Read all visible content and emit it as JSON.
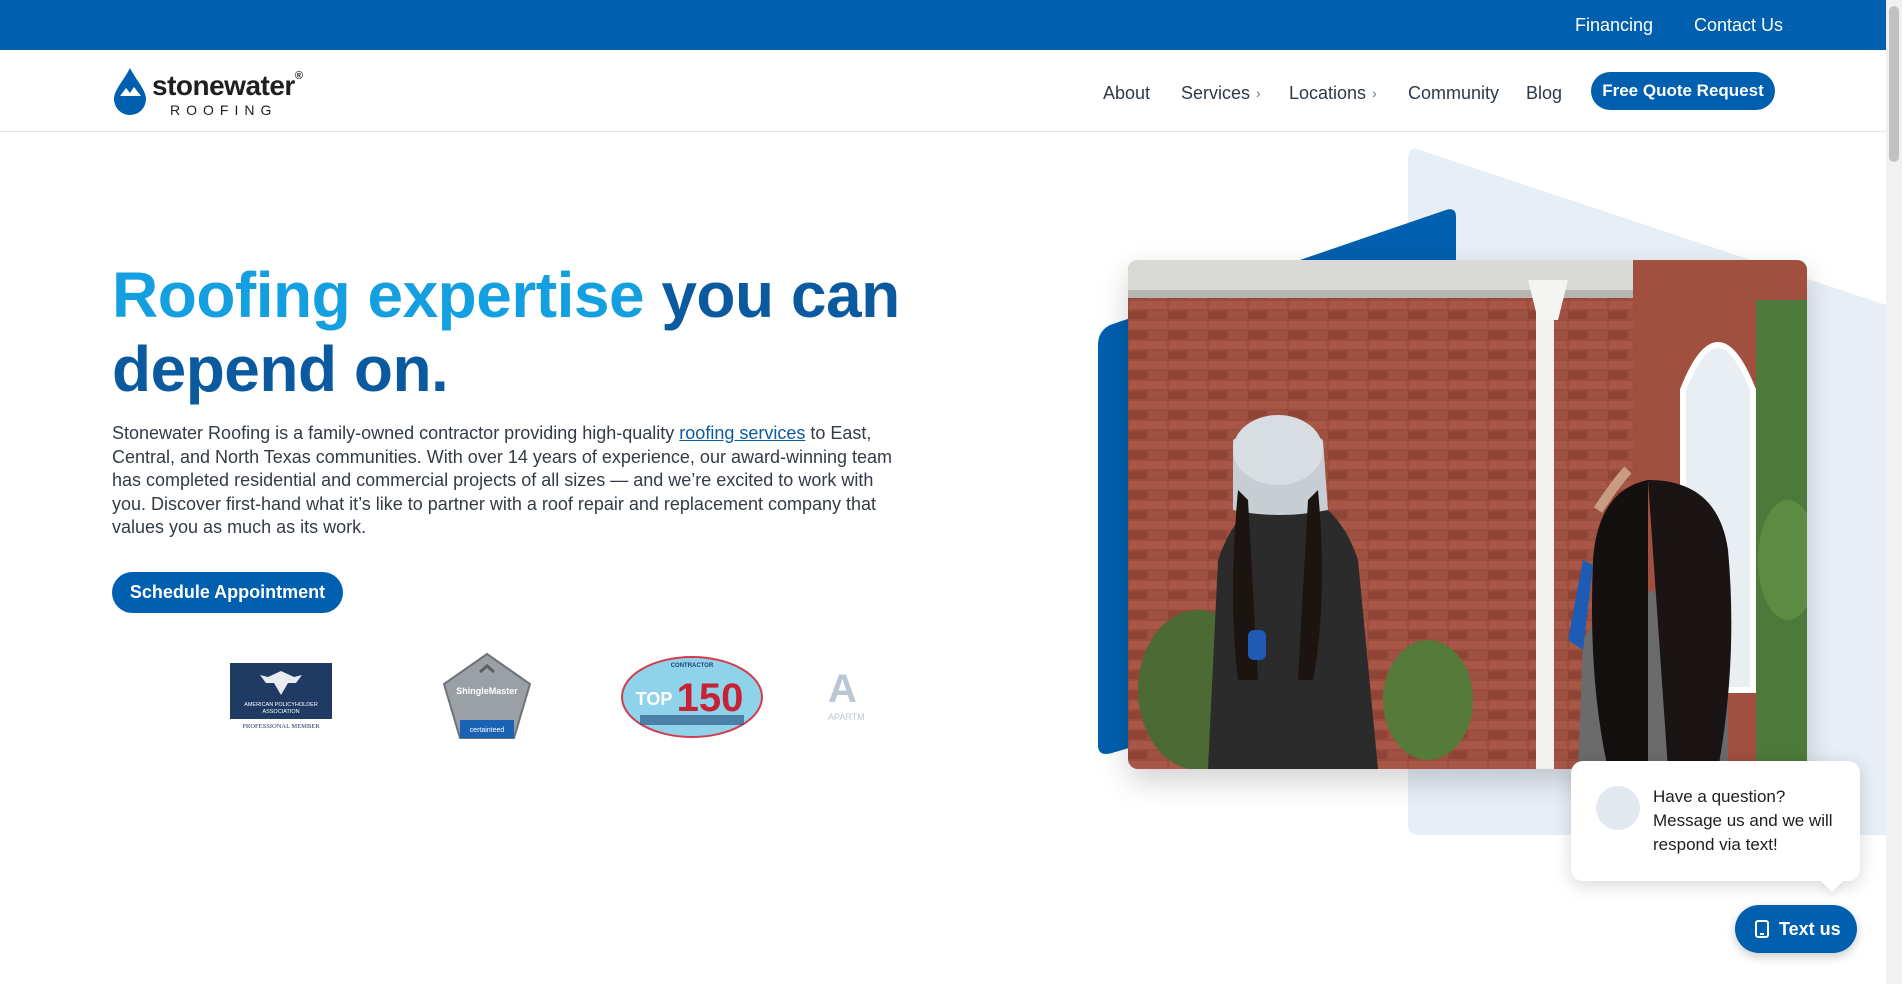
{
  "topbar": {
    "links": [
      "Financing",
      "Contact Us"
    ]
  },
  "logo": {
    "name": "stonewater",
    "registered": "®",
    "sub": "ROOFING"
  },
  "nav": {
    "about": "About",
    "services": "Services",
    "locations": "Locations",
    "community": "Community",
    "blog": "Blog",
    "chevron": "›",
    "quote_button": "Free Quote Request"
  },
  "hero": {
    "headline_light": "Roofing expertise",
    "headline_dark": "you can depend on.",
    "intro_before": "Stonewater Roofing is a family-owned contractor providing high-quality ",
    "intro_link": "roofing services",
    "intro_after": " to East, Central, and North Texas communities. With over 14 years of experience, our award-winning team has completed residential and commercial projects of all sizes — and we’re excited to work with you. Discover first-hand what it’s like to partner with a roof repair and replacement company that values you as much as its work.",
    "schedule_button": "Schedule Appointment"
  },
  "badges": {
    "apa_line1": "AMERICAN POLICYHOLDER",
    "apa_line2": "ASSOCIATION",
    "apa_line3": "PROFESSIONAL MEMBER",
    "shingle_title": "ShingleMaster",
    "shingle_brand": "certainteed",
    "top150_small": "CONTRACTOR",
    "top150_text": "TOP",
    "top150_number": "150",
    "apart_text": "APARTM"
  },
  "chat": {
    "message": "Have a question? Message us and we will respond via text!",
    "button": "Text us"
  },
  "colors": {
    "brand_blue": "#005fae",
    "light_blue": "#14a0e0",
    "dark_blue": "#0b5aa0"
  }
}
